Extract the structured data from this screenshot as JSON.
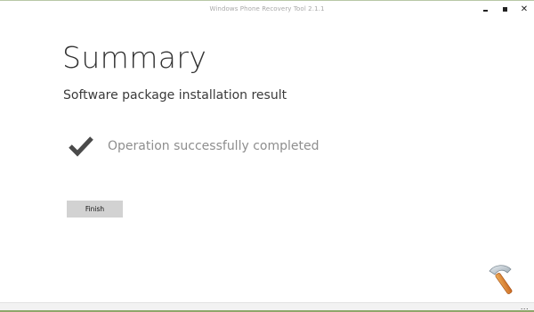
{
  "window": {
    "title": "Windows Phone Recovery Tool 2.1.1",
    "controls": {
      "minimize_icon": "minimize-icon",
      "maximize_icon": "maximize-icon",
      "close_icon": "close-icon",
      "close_glyph": "✕"
    }
  },
  "main": {
    "title": "Summary",
    "subtitle": "Software package installation result",
    "status": {
      "icon": "checkmark-icon",
      "text": "Operation successfully completed"
    },
    "finish_label": "Finish"
  },
  "footer": {
    "more_glyph": "...",
    "more_icon": "more-options-icon"
  },
  "colors": {
    "accent_green": "#8fa66a",
    "title_text": "#333333",
    "status_text": "#8e8e8e",
    "button_bg": "#d2d2d2"
  }
}
